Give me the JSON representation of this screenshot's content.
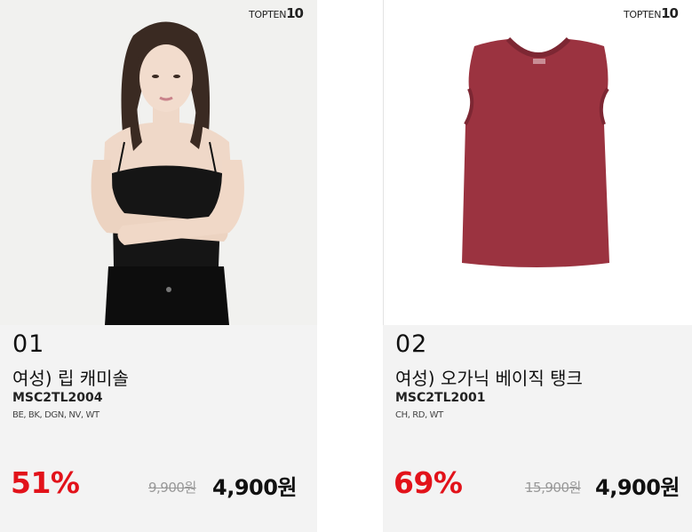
{
  "products": [
    {
      "brand_text": "TOPTEN",
      "brand_number": "10",
      "rank": "01",
      "name": "여성) 립 캐미솔",
      "code": "MSC2TL2004",
      "colors": "BE, BK, DGN, NV, WT",
      "discount": "51%",
      "original_price": "9,900원",
      "sale_price": "4,900원"
    },
    {
      "brand_text": "TOPTEN",
      "brand_number": "10",
      "rank": "02",
      "name": "여성) 오가닉 베이직 탱크",
      "code": "MSC2TL2001",
      "colors": "CH, RD, WT",
      "discount": "69%",
      "original_price": "15,900원",
      "sale_price": "4,900원"
    }
  ],
  "colors": {
    "discount_red": "#e2121a",
    "card_bg": "#f3f3f3",
    "tank_red": "#9b3340"
  }
}
